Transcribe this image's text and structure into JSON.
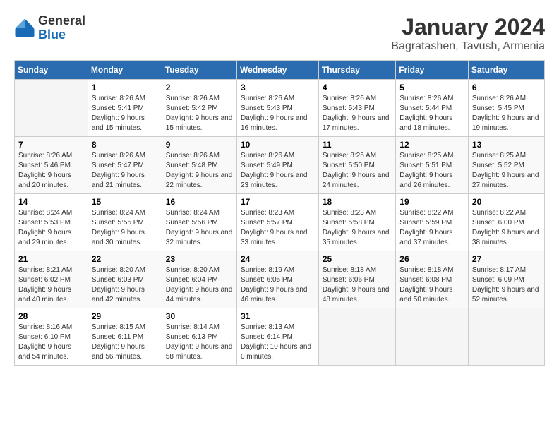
{
  "logo": {
    "general": "General",
    "blue": "Blue"
  },
  "title": "January 2024",
  "subtitle": "Bagratashen, Tavush, Armenia",
  "headers": [
    "Sunday",
    "Monday",
    "Tuesday",
    "Wednesday",
    "Thursday",
    "Friday",
    "Saturday"
  ],
  "weeks": [
    [
      {
        "day": "",
        "sunrise": "",
        "sunset": "",
        "daylight": ""
      },
      {
        "day": "1",
        "sunrise": "Sunrise: 8:26 AM",
        "sunset": "Sunset: 5:41 PM",
        "daylight": "Daylight: 9 hours and 15 minutes."
      },
      {
        "day": "2",
        "sunrise": "Sunrise: 8:26 AM",
        "sunset": "Sunset: 5:42 PM",
        "daylight": "Daylight: 9 hours and 15 minutes."
      },
      {
        "day": "3",
        "sunrise": "Sunrise: 8:26 AM",
        "sunset": "Sunset: 5:43 PM",
        "daylight": "Daylight: 9 hours and 16 minutes."
      },
      {
        "day": "4",
        "sunrise": "Sunrise: 8:26 AM",
        "sunset": "Sunset: 5:43 PM",
        "daylight": "Daylight: 9 hours and 17 minutes."
      },
      {
        "day": "5",
        "sunrise": "Sunrise: 8:26 AM",
        "sunset": "Sunset: 5:44 PM",
        "daylight": "Daylight: 9 hours and 18 minutes."
      },
      {
        "day": "6",
        "sunrise": "Sunrise: 8:26 AM",
        "sunset": "Sunset: 5:45 PM",
        "daylight": "Daylight: 9 hours and 19 minutes."
      }
    ],
    [
      {
        "day": "7",
        "sunrise": "Sunrise: 8:26 AM",
        "sunset": "Sunset: 5:46 PM",
        "daylight": "Daylight: 9 hours and 20 minutes."
      },
      {
        "day": "8",
        "sunrise": "Sunrise: 8:26 AM",
        "sunset": "Sunset: 5:47 PM",
        "daylight": "Daylight: 9 hours and 21 minutes."
      },
      {
        "day": "9",
        "sunrise": "Sunrise: 8:26 AM",
        "sunset": "Sunset: 5:48 PM",
        "daylight": "Daylight: 9 hours and 22 minutes."
      },
      {
        "day": "10",
        "sunrise": "Sunrise: 8:26 AM",
        "sunset": "Sunset: 5:49 PM",
        "daylight": "Daylight: 9 hours and 23 minutes."
      },
      {
        "day": "11",
        "sunrise": "Sunrise: 8:25 AM",
        "sunset": "Sunset: 5:50 PM",
        "daylight": "Daylight: 9 hours and 24 minutes."
      },
      {
        "day": "12",
        "sunrise": "Sunrise: 8:25 AM",
        "sunset": "Sunset: 5:51 PM",
        "daylight": "Daylight: 9 hours and 26 minutes."
      },
      {
        "day": "13",
        "sunrise": "Sunrise: 8:25 AM",
        "sunset": "Sunset: 5:52 PM",
        "daylight": "Daylight: 9 hours and 27 minutes."
      }
    ],
    [
      {
        "day": "14",
        "sunrise": "Sunrise: 8:24 AM",
        "sunset": "Sunset: 5:53 PM",
        "daylight": "Daylight: 9 hours and 29 minutes."
      },
      {
        "day": "15",
        "sunrise": "Sunrise: 8:24 AM",
        "sunset": "Sunset: 5:55 PM",
        "daylight": "Daylight: 9 hours and 30 minutes."
      },
      {
        "day": "16",
        "sunrise": "Sunrise: 8:24 AM",
        "sunset": "Sunset: 5:56 PM",
        "daylight": "Daylight: 9 hours and 32 minutes."
      },
      {
        "day": "17",
        "sunrise": "Sunrise: 8:23 AM",
        "sunset": "Sunset: 5:57 PM",
        "daylight": "Daylight: 9 hours and 33 minutes."
      },
      {
        "day": "18",
        "sunrise": "Sunrise: 8:23 AM",
        "sunset": "Sunset: 5:58 PM",
        "daylight": "Daylight: 9 hours and 35 minutes."
      },
      {
        "day": "19",
        "sunrise": "Sunrise: 8:22 AM",
        "sunset": "Sunset: 5:59 PM",
        "daylight": "Daylight: 9 hours and 37 minutes."
      },
      {
        "day": "20",
        "sunrise": "Sunrise: 8:22 AM",
        "sunset": "Sunset: 6:00 PM",
        "daylight": "Daylight: 9 hours and 38 minutes."
      }
    ],
    [
      {
        "day": "21",
        "sunrise": "Sunrise: 8:21 AM",
        "sunset": "Sunset: 6:02 PM",
        "daylight": "Daylight: 9 hours and 40 minutes."
      },
      {
        "day": "22",
        "sunrise": "Sunrise: 8:20 AM",
        "sunset": "Sunset: 6:03 PM",
        "daylight": "Daylight: 9 hours and 42 minutes."
      },
      {
        "day": "23",
        "sunrise": "Sunrise: 8:20 AM",
        "sunset": "Sunset: 6:04 PM",
        "daylight": "Daylight: 9 hours and 44 minutes."
      },
      {
        "day": "24",
        "sunrise": "Sunrise: 8:19 AM",
        "sunset": "Sunset: 6:05 PM",
        "daylight": "Daylight: 9 hours and 46 minutes."
      },
      {
        "day": "25",
        "sunrise": "Sunrise: 8:18 AM",
        "sunset": "Sunset: 6:06 PM",
        "daylight": "Daylight: 9 hours and 48 minutes."
      },
      {
        "day": "26",
        "sunrise": "Sunrise: 8:18 AM",
        "sunset": "Sunset: 6:08 PM",
        "daylight": "Daylight: 9 hours and 50 minutes."
      },
      {
        "day": "27",
        "sunrise": "Sunrise: 8:17 AM",
        "sunset": "Sunset: 6:09 PM",
        "daylight": "Daylight: 9 hours and 52 minutes."
      }
    ],
    [
      {
        "day": "28",
        "sunrise": "Sunrise: 8:16 AM",
        "sunset": "Sunset: 6:10 PM",
        "daylight": "Daylight: 9 hours and 54 minutes."
      },
      {
        "day": "29",
        "sunrise": "Sunrise: 8:15 AM",
        "sunset": "Sunset: 6:11 PM",
        "daylight": "Daylight: 9 hours and 56 minutes."
      },
      {
        "day": "30",
        "sunrise": "Sunrise: 8:14 AM",
        "sunset": "Sunset: 6:13 PM",
        "daylight": "Daylight: 9 hours and 58 minutes."
      },
      {
        "day": "31",
        "sunrise": "Sunrise: 8:13 AM",
        "sunset": "Sunset: 6:14 PM",
        "daylight": "Daylight: 10 hours and 0 minutes."
      },
      {
        "day": "",
        "sunrise": "",
        "sunset": "",
        "daylight": ""
      },
      {
        "day": "",
        "sunrise": "",
        "sunset": "",
        "daylight": ""
      },
      {
        "day": "",
        "sunrise": "",
        "sunset": "",
        "daylight": ""
      }
    ]
  ]
}
